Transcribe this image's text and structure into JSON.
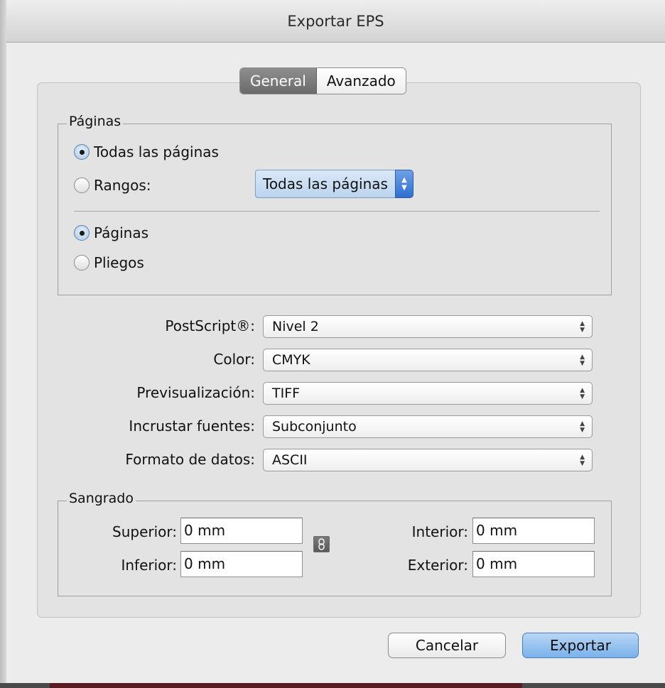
{
  "window": {
    "title": "Exportar EPS"
  },
  "tabs": [
    {
      "label": "General",
      "active": true
    },
    {
      "label": "Avanzado",
      "active": false
    }
  ],
  "pages_group": {
    "title": "Páginas",
    "all_pages_label": "Todas las páginas",
    "ranges_label": "Rangos:",
    "ranges_value": "Todas las páginas",
    "pages_label": "Páginas",
    "spreads_label": "Pliegos",
    "selected_scope": "Todas las páginas",
    "selected_layout": "Páginas"
  },
  "settings": [
    {
      "label": "PostScript®:",
      "value": "Nivel 2"
    },
    {
      "label": "Color:",
      "value": "CMYK"
    },
    {
      "label": "Previsualización:",
      "value": "TIFF"
    },
    {
      "label": "Incrustar fuentes:",
      "value": "Subconjunto"
    },
    {
      "label": "Formato de datos:",
      "value": "ASCII"
    }
  ],
  "bleed": {
    "title": "Sangrado",
    "top_label": "Superior:",
    "top_value": "0 mm",
    "bottom_label": "Inferior:",
    "bottom_value": "0 mm",
    "inside_label": "Interior:",
    "inside_value": "0 mm",
    "outside_label": "Exterior:",
    "outside_value": "0 mm"
  },
  "buttons": {
    "cancel": "Cancelar",
    "export": "Exportar"
  },
  "colors": {
    "accent": "#79b1ea",
    "active_tab": "#7a7a7a"
  }
}
